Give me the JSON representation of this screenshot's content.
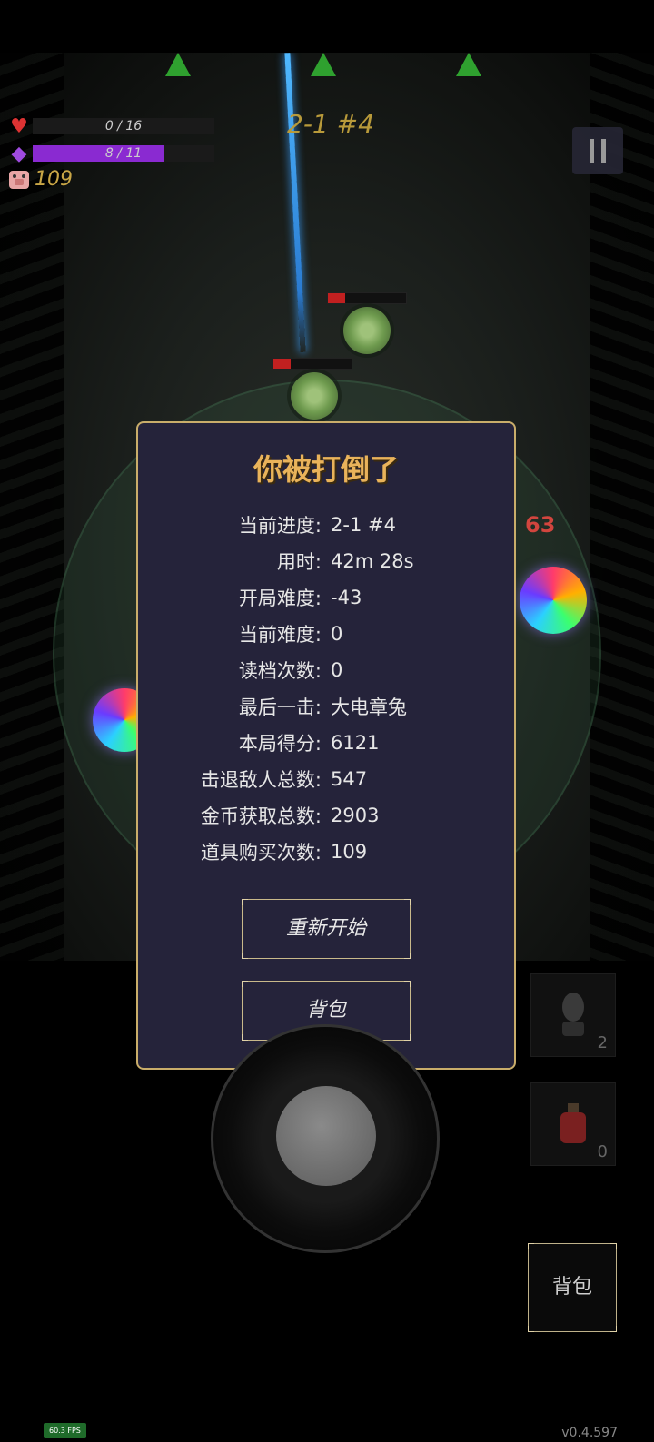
{
  "hud": {
    "hp_text": "0 / 16",
    "hp_fraction": 0.0,
    "mana_text": "8 / 11",
    "mana_fraction": 0.727,
    "coins": "109",
    "stage": "2-1 #4",
    "pause_icon": "pause-icon"
  },
  "scene": {
    "damage_numbers": [
      "63",
      "63"
    ]
  },
  "dialog": {
    "title": "你被打倒了",
    "stats": [
      {
        "label": "当前进度:",
        "value": "2-1 #4"
      },
      {
        "label": "用时:",
        "value": "42m 28s"
      },
      {
        "label": "开局难度:",
        "value": "-43"
      },
      {
        "label": "当前难度:",
        "value": "0"
      },
      {
        "label": "读档次数:",
        "value": "0"
      },
      {
        "label": "最后一击:",
        "value": "大电章兔"
      },
      {
        "label": "本局得分:",
        "value": "6121"
      },
      {
        "label": "击退敌人总数:",
        "value": "547"
      },
      {
        "label": "金币获取总数:",
        "value": "2903"
      },
      {
        "label": "道具购买次数:",
        "value": "109"
      }
    ],
    "restart_label": "重新开始",
    "bag_label": "背包"
  },
  "controls": {
    "slot1_count": "2",
    "slot2_count": "0",
    "bag_label": "背包"
  },
  "footer": {
    "fps": "60.3 FPS",
    "version": "v0.4.597"
  },
  "colors": {
    "dialog_bg": "#25233a",
    "dialog_border": "#c9ad6a",
    "title": "#e9b35a",
    "mana": "#8a2ad1",
    "stage": "#b89a3a"
  }
}
